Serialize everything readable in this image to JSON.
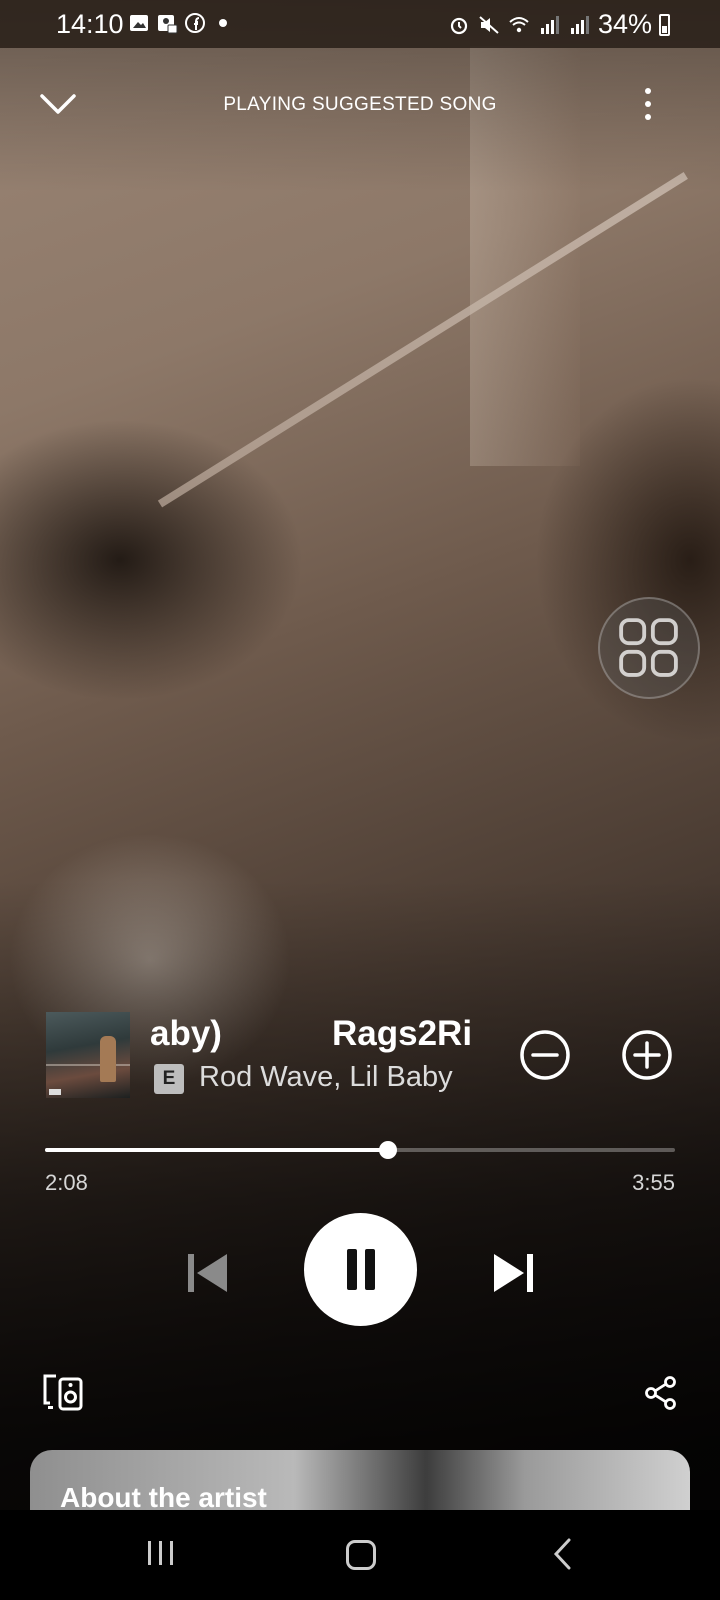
{
  "status_bar": {
    "time": "14:10",
    "battery": "34%",
    "left_icons": [
      "gallery-icon",
      "contact-facebook-icon",
      "facebook-icon",
      "dot-icon"
    ],
    "right_icons": [
      "alarm-icon",
      "mute-icon",
      "wifi-icon",
      "signal-icon",
      "signal-icon",
      "battery-icon"
    ]
  },
  "header": {
    "title": "PLAYING SUGGESTED SONG",
    "collapse_icon": "chevron-down-icon",
    "more_icon": "more-vertical-icon"
  },
  "track": {
    "title_fragment_left": "aby)",
    "title_fragment_right": "Rags2Ri",
    "explicit_badge": "E",
    "artists": "Rod Wave, Lil Baby"
  },
  "playback": {
    "elapsed": "2:08",
    "total": "3:55",
    "progress_fraction": 0.544
  },
  "controls": {
    "remove_icon": "minus-circle-icon",
    "add_icon": "plus-circle-icon",
    "previous_icon": "skip-previous-icon",
    "pause_icon": "pause-icon",
    "next_icon": "skip-next-icon",
    "devices_icon": "devices-icon",
    "share_icon": "share-icon",
    "floating_icon": "grid-icon"
  },
  "about_card": {
    "title": "About the artist"
  },
  "nav_bar": {
    "recent_icon": "recent-apps-icon",
    "home_icon": "home-icon",
    "back_icon": "back-icon"
  },
  "colors": {
    "accent": "#ffffff",
    "progress_track": "#5a5654",
    "explicit_badge_bg": "#bdbdbd"
  }
}
